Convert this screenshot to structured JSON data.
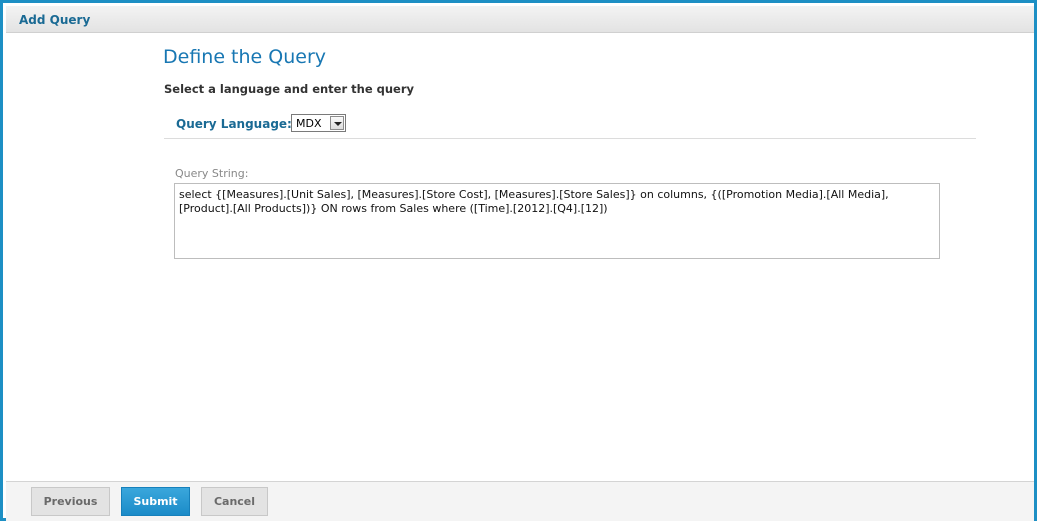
{
  "titlebar": {
    "title": "Add Query"
  },
  "main": {
    "heading": "Define the Query",
    "subheading": "Select a language and enter the query",
    "language": {
      "label": "Query Language:",
      "selected": "MDX"
    },
    "query_string": {
      "label": "Query String:",
      "value": "select {[Measures].[Unit Sales], [Measures].[Store Cost], [Measures].[Store Sales]} on columns, {([Promotion Media].[All Media], [Product].[All Products])} ON rows from Sales where ([Time].[2012].[Q4].[12])"
    }
  },
  "footer": {
    "previous_label": "Previous",
    "submit_label": "Submit",
    "cancel_label": "Cancel"
  },
  "colors": {
    "accent": "#1d8fc4",
    "heading": "#1877b3",
    "label": "#1a6a94",
    "submit": "#2a9ad2"
  }
}
